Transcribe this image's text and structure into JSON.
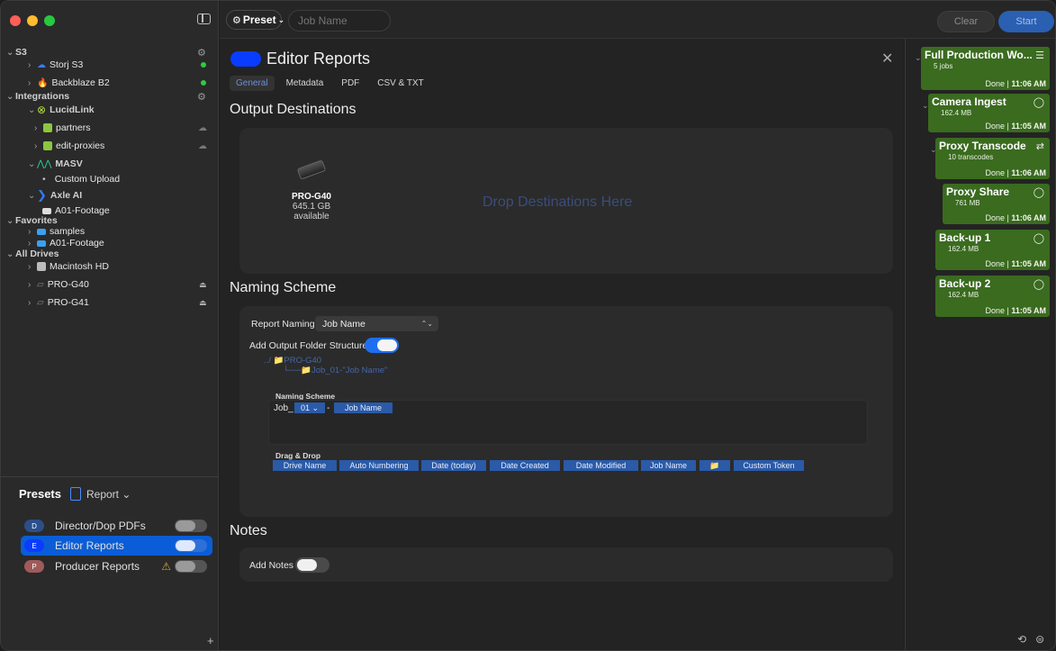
{
  "toolbar": {
    "preset_label": "Preset",
    "jobname_placeholder": "Job Name",
    "clear_label": "Clear",
    "start_label": "Start"
  },
  "sidebar": {
    "s3_header": "S3",
    "storj": "Storj S3",
    "backblaze": "Backblaze B2",
    "integrations_header": "Integrations",
    "lucidlink": "LucidLink",
    "partners": "partners",
    "edit_proxies": "edit-proxies",
    "masv": "MASV",
    "custom_upload": "Custom Upload",
    "axle": "Axle AI",
    "a01_footage": "A01-Footage",
    "favorites_header": "Favorites",
    "samples": "samples",
    "fav_a01": "A01-Footage",
    "all_drives_header": "All Drives",
    "macintosh": "Macintosh HD",
    "pro_g40": "PRO-G40",
    "pro_g41": "PRO-G41"
  },
  "presets": {
    "title": "Presets",
    "report_label": "Report",
    "items": [
      {
        "badge": "D",
        "name": "Director/Dop PDFs",
        "color": "#2a4f8a"
      },
      {
        "badge": "E",
        "name": "Editor Reports",
        "color": "#0a3cff"
      },
      {
        "badge": "P",
        "name": "Producer Reports",
        "color": "#a05a5a"
      }
    ]
  },
  "main": {
    "title": "Editor Reports",
    "tabs": [
      "General",
      "Metadata",
      "PDF",
      "CSV & TXT"
    ],
    "output_destinations": "Output Destinations",
    "drive": {
      "name": "PRO-G40",
      "size": "645.1 GB",
      "available": "available"
    },
    "drop_text": "Drop Destinations Here",
    "naming_scheme_header": "Naming Scheme",
    "report_naming_label": "Report Naming",
    "report_naming_value": "Job Name",
    "add_output_folder_label": "Add Output Folder Structure",
    "path_line1": "../ 📁PRO-G40",
    "path_line2": "└──📁Job_01-\"Job Name\"",
    "naming_scheme_sub": "Naming Scheme",
    "scheme_prefix": "Job_",
    "scheme_num": "01",
    "scheme_dash": "-",
    "scheme_jobname": "Job Name",
    "drag_drop_label": "Drag & Drop",
    "tokens": [
      "Drive Name",
      "Auto Numbering",
      "Date (today)",
      "Date Created",
      "Date Modified",
      "Job Name",
      "📁",
      "Custom Token"
    ],
    "notes_header": "Notes",
    "add_notes_label": "Add Notes"
  },
  "jobs": [
    {
      "title": "Full Production Wo...",
      "sub": "5 jobs",
      "status": "Done",
      "time": "11:06 AM"
    },
    {
      "title": "Camera Ingest",
      "sub": "162.4 MB",
      "status": "Done",
      "time": "11:05 AM"
    },
    {
      "title": "Proxy Transcode",
      "sub": "10 transcodes",
      "status": "Done",
      "time": "11:06 AM"
    },
    {
      "title": "Proxy Share",
      "sub": "761 MB",
      "status": "Done",
      "time": "11:06 AM"
    },
    {
      "title": "Back-up 1",
      "sub": "162.4 MB",
      "status": "Done",
      "time": "11:05 AM"
    },
    {
      "title": "Back-up 2",
      "sub": "162.4 MB",
      "status": "Done",
      "time": "11:05 AM"
    }
  ],
  "colors": {
    "accent": "#0a5dd6",
    "job_green": "#3a6b1f",
    "token_blue": "#2a5aa8"
  }
}
